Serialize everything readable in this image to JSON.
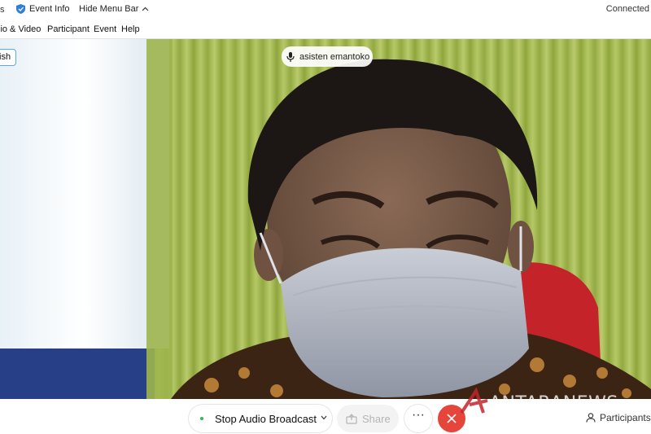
{
  "topbar": {
    "cut_label": "s",
    "event_info": "Event Info",
    "hide_menu_bar": "Hide Menu Bar",
    "status": "Connected"
  },
  "menu": {
    "items": [
      "lio & Video",
      "Participant",
      "Event",
      "Help"
    ]
  },
  "video": {
    "language_button": "ish",
    "speaker_name": "asisten emantoko"
  },
  "controls": {
    "audio_button": "Stop Audio Broadcast",
    "share_button": "Share",
    "more_label": "···",
    "participants_label": "Participants"
  },
  "watermark": {
    "text": "ANTARANEWS"
  },
  "colors": {
    "end_button": "#e5453b",
    "broadcast_dot": "#2eb85c",
    "accent": "#5fa8e6"
  }
}
